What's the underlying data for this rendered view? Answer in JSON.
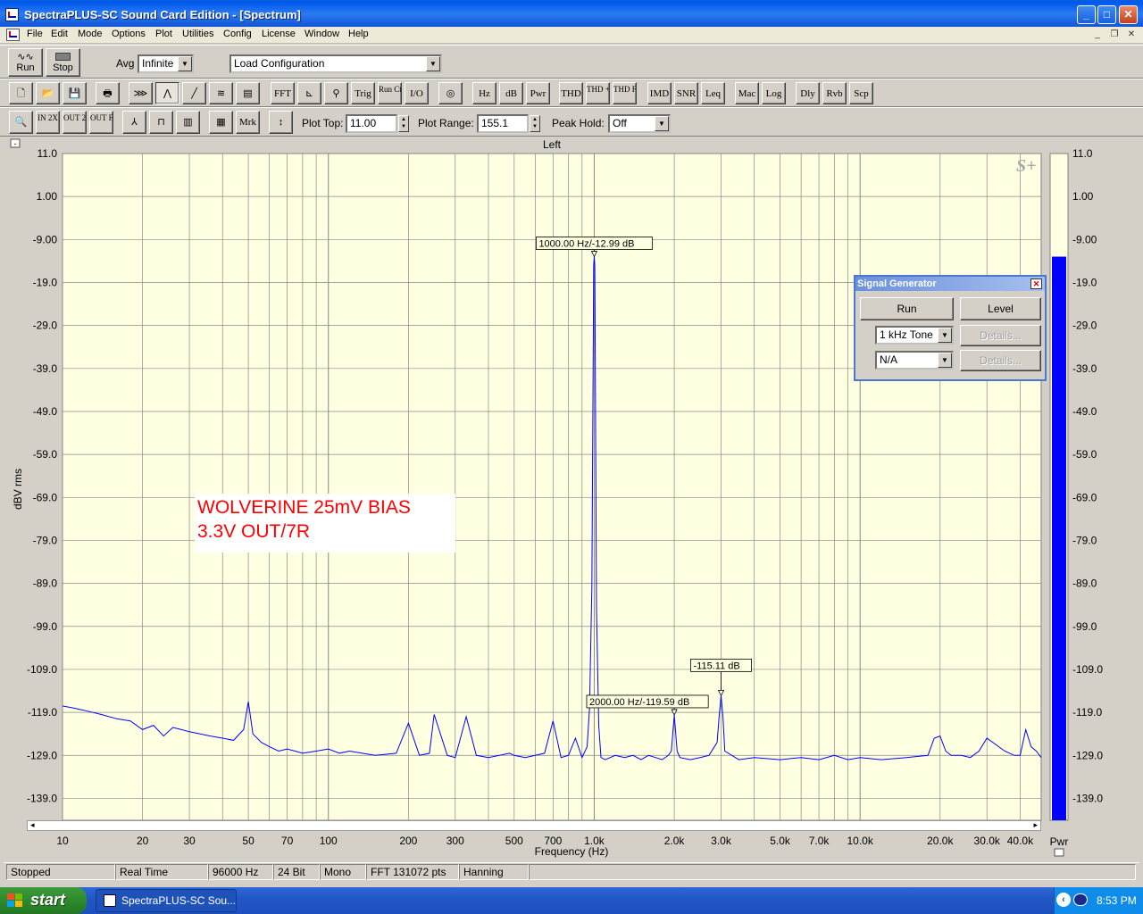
{
  "window": {
    "title": "SpectraPLUS-SC Sound Card Edition - [Spectrum]",
    "min_glyph": "_",
    "max_glyph": "□",
    "close_glyph": "✕"
  },
  "menu": [
    "File",
    "Edit",
    "Mode",
    "Options",
    "Plot",
    "Utilities",
    "Config",
    "License",
    "Window",
    "Help"
  ],
  "toolbar1": {
    "run_label": "Run",
    "stop_label": "Stop",
    "avg_label": "Avg",
    "avg_value": "Infinite",
    "config_value": "Load Configuration"
  },
  "toolbar2": {
    "buttons": [
      "FFT",
      "Trig",
      "Run Ctrl",
      "I/O",
      "Hz",
      "dB",
      "Pwr",
      "THD",
      "THD +N",
      "THD Freq",
      "IMD",
      "SNR",
      "Leq",
      "Mac",
      "Log",
      "Dly",
      "Rvb",
      "Scp"
    ]
  },
  "toolbar3": {
    "zoom_in_label": "IN 2X",
    "zoom_out_label": "OUT 2X",
    "zoom_full_label": "OUT FULL",
    "mrk_label": "Mrk",
    "plot_top_label": "Plot Top:",
    "plot_top_value": "11.00",
    "plot_range_label": "Plot Range:",
    "plot_range_value": "155.1",
    "peak_hold_label": "Peak Hold:",
    "peak_hold_value": "Off"
  },
  "plot": {
    "channel_label": "Left",
    "logo": "S+",
    "pwr_label": "Pwr",
    "pwr_level_dB": -12.99,
    "annotation_line1": "WOLVERINE 25mV BIAS",
    "annotation_line2": "3.3V OUT/7R",
    "markers": [
      {
        "label": "1000.00 Hz/-12.99 dB",
        "freq": 1000,
        "db": -12.99
      },
      {
        "label": "2000.00 Hz/-119.59 dB",
        "freq": 2000,
        "db": -119.59
      },
      {
        "label": "-115.11 dB",
        "freq": 3000,
        "db": -115.11
      }
    ],
    "colors": {
      "background": "#ffffe1",
      "trace": "#0000ff",
      "annotation": "#ff0000",
      "pwr_bar": "#0000ff"
    }
  },
  "chart_data": {
    "type": "line",
    "xlabel": "Frequency (Hz)",
    "ylabel": "dBV rms",
    "x_scale": "log",
    "xlim": [
      10,
      48000
    ],
    "ylim": [
      -144.1,
      11.0
    ],
    "grid": true,
    "y_ticks": [
      "11.0",
      "1.00",
      "-9.00",
      "-19.0",
      "-29.0",
      "-39.0",
      "-49.0",
      "-59.0",
      "-69.0",
      "-79.0",
      "-89.0",
      "-99.0",
      "-109.0",
      "-119.0",
      "-129.0",
      "-139.0"
    ],
    "x_ticks": [
      {
        "v": 10,
        "l": "10"
      },
      {
        "v": 20,
        "l": "20"
      },
      {
        "v": 30,
        "l": "30"
      },
      {
        "v": 50,
        "l": "50"
      },
      {
        "v": 70,
        "l": "70"
      },
      {
        "v": 100,
        "l": "100"
      },
      {
        "v": 200,
        "l": "200"
      },
      {
        "v": 300,
        "l": "300"
      },
      {
        "v": 500,
        "l": "500"
      },
      {
        "v": 700,
        "l": "700"
      },
      {
        "v": 1000,
        "l": "1.0k"
      },
      {
        "v": 2000,
        "l": "2.0k"
      },
      {
        "v": 3000,
        "l": "3.0k"
      },
      {
        "v": 5000,
        "l": "5.0k"
      },
      {
        "v": 7000,
        "l": "7.0k"
      },
      {
        "v": 10000,
        "l": "10.0k"
      },
      {
        "v": 20000,
        "l": "20.0k"
      },
      {
        "v": 30000,
        "l": "30.0k"
      },
      {
        "v": 40000,
        "l": "40.0k"
      }
    ],
    "series": [
      {
        "freq": [
          10,
          11,
          12,
          14,
          16,
          18,
          20,
          22,
          24,
          26,
          28,
          30,
          33,
          36,
          40,
          44,
          48,
          50,
          52,
          56,
          60,
          65,
          70,
          75,
          80,
          90,
          100,
          110,
          120,
          150,
          180,
          200,
          220,
          240,
          250,
          280,
          300,
          330,
          360,
          400,
          440,
          480,
          500,
          550,
          600,
          650,
          700,
          750,
          800,
          850,
          900,
          940,
          960,
          980,
          990,
          995,
          1000,
          1005,
          1010,
          1020,
          1040,
          1060,
          1100,
          1200,
          1300,
          1400,
          1500,
          1600,
          1700,
          1800,
          1900,
          1950,
          2000,
          2050,
          2100,
          2300,
          2500,
          2700,
          2900,
          2950,
          3000,
          3050,
          3100,
          3500,
          4000,
          5000,
          6000,
          7000,
          8000,
          9000,
          10000,
          12000,
          15000,
          18000,
          19000,
          20000,
          21000,
          22000,
          24000,
          26000,
          28000,
          30000,
          35000,
          38000,
          40000,
          42000,
          44000,
          46000,
          48000
        ],
        "db": [
          -117.5,
          -118,
          -118.5,
          -119.5,
          -120.5,
          -121,
          -123,
          -122,
          -124.5,
          -122.5,
          -123,
          -123.5,
          -124,
          -124.5,
          -125,
          -125.5,
          -123,
          -116.5,
          -124,
          -126,
          -127,
          -128,
          -127.5,
          -128,
          -128.5,
          -128,
          -127.5,
          -128.5,
          -128,
          -129,
          -128.5,
          -121.5,
          -129,
          -128.5,
          -119.5,
          -129,
          -129.5,
          -120,
          -129,
          -129.5,
          -129,
          -128.5,
          -129,
          -129.5,
          -129,
          -128.5,
          -121,
          -129.5,
          -129,
          -125,
          -129.5,
          -127,
          -118,
          -90,
          -40,
          -15,
          -12.99,
          -15,
          -40,
          -95,
          -122,
          -129.5,
          -130,
          -129,
          -129.5,
          -129,
          -130,
          -129,
          -129.5,
          -130,
          -129,
          -128,
          -119.59,
          -128,
          -129.5,
          -130,
          -129.5,
          -129,
          -126,
          -120,
          -115.11,
          -120,
          -128,
          -130,
          -129.5,
          -130,
          -129.5,
          -130,
          -129,
          -130,
          -129.5,
          -130,
          -129.5,
          -129,
          -125,
          -124.5,
          -128,
          -129,
          -129,
          -129.5,
          -128,
          -125,
          -128,
          -129,
          -129,
          -123,
          -127,
          -128,
          -129.5
        ]
      }
    ]
  },
  "siggen": {
    "title": "Signal Generator",
    "run_label": "Run",
    "level_label": "Level",
    "tone_value": "1 kHz Tone",
    "second_value": "N/A",
    "details_label": "Details..."
  },
  "status": [
    "Stopped",
    "Real Time",
    "96000 Hz",
    "24 Bit",
    "Mono",
    "FFT 131072 pts",
    "Hanning"
  ],
  "taskbar": {
    "start_label": "start",
    "task_label": "SpectraPLUS-SC Sou...",
    "clock": "8:53 PM"
  }
}
